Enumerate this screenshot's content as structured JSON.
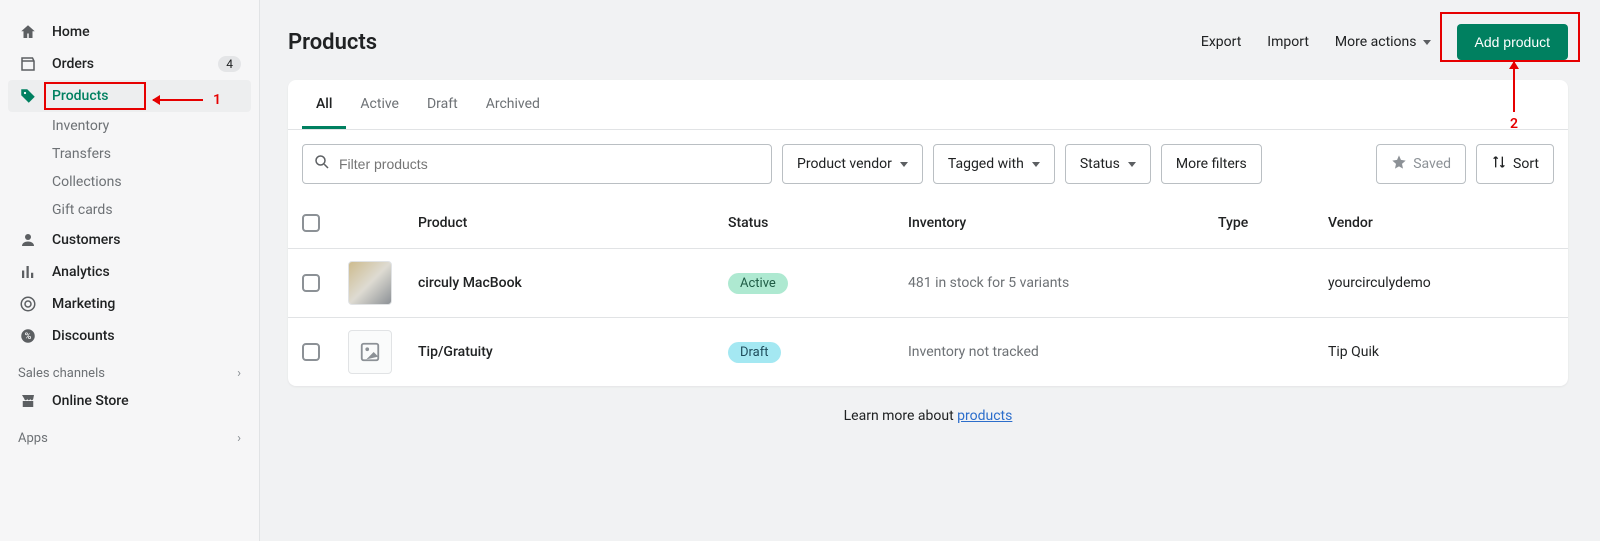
{
  "sidebar": {
    "items": [
      {
        "label": "Home"
      },
      {
        "label": "Orders",
        "badge": "4"
      },
      {
        "label": "Products",
        "active": true
      },
      {
        "label": "Customers"
      },
      {
        "label": "Analytics"
      },
      {
        "label": "Marketing"
      },
      {
        "label": "Discounts"
      }
    ],
    "products_sub": [
      {
        "label": "Inventory"
      },
      {
        "label": "Transfers"
      },
      {
        "label": "Collections"
      },
      {
        "label": "Gift cards"
      }
    ],
    "sales_channels": {
      "title": "Sales channels",
      "items": [
        {
          "label": "Online Store"
        }
      ]
    },
    "apps": {
      "title": "Apps"
    }
  },
  "annotations": {
    "one": "1",
    "two": "2"
  },
  "page": {
    "title": "Products",
    "actions": {
      "export": "Export",
      "import": "Import",
      "more": "More actions",
      "primary": "Add product"
    }
  },
  "tabs": [
    {
      "label": "All",
      "active": true
    },
    {
      "label": "Active"
    },
    {
      "label": "Draft"
    },
    {
      "label": "Archived"
    }
  ],
  "filters": {
    "placeholder": "Filter products",
    "vendor": "Product vendor",
    "tagged": "Tagged with",
    "status": "Status",
    "more": "More filters",
    "saved": "Saved",
    "sort": "Sort"
  },
  "columns": {
    "product": "Product",
    "status": "Status",
    "inventory": "Inventory",
    "type": "Type",
    "vendor": "Vendor"
  },
  "rows": [
    {
      "name": "circuly MacBook",
      "status": "Active",
      "status_kind": "active",
      "inventory": "481 in stock for 5 variants",
      "type": "",
      "vendor": "yourcirculydemo",
      "thumb": "photo"
    },
    {
      "name": "Tip/Gratuity",
      "status": "Draft",
      "status_kind": "draft",
      "inventory": "Inventory not tracked",
      "type": "",
      "vendor": "Tip Quik",
      "thumb": "placeholder"
    }
  ],
  "footer": {
    "text": "Learn more about ",
    "link": "products"
  }
}
